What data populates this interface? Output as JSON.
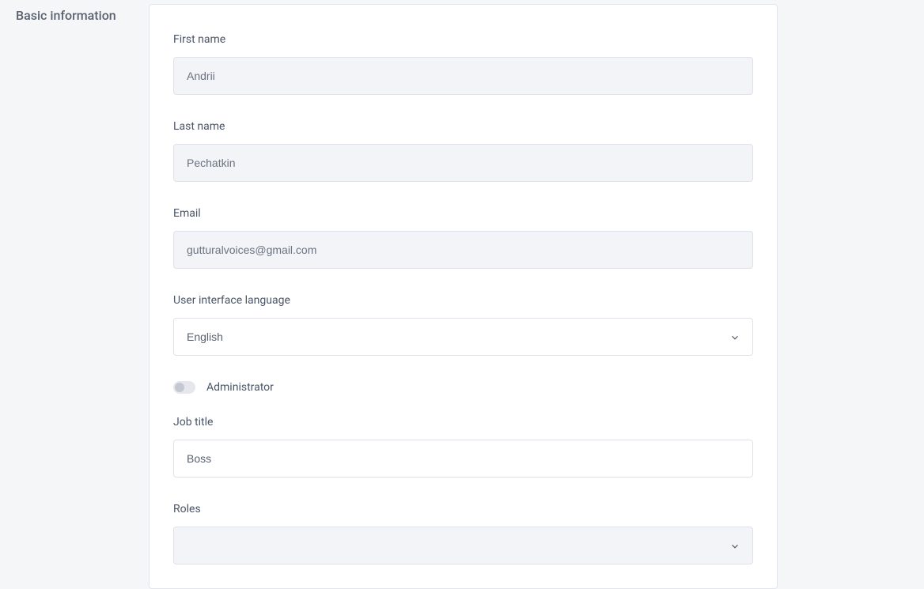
{
  "section": {
    "title": "Basic information"
  },
  "form": {
    "firstName": {
      "label": "First name",
      "value": "Andrii"
    },
    "lastName": {
      "label": "Last name",
      "value": "Pechatkin"
    },
    "email": {
      "label": "Email",
      "value": "gutturalvoices@gmail.com"
    },
    "language": {
      "label": "User interface language",
      "value": "English"
    },
    "administrator": {
      "label": "Administrator"
    },
    "jobTitle": {
      "label": "Job title",
      "value": "Boss"
    },
    "roles": {
      "label": "Roles",
      "value": ""
    }
  }
}
